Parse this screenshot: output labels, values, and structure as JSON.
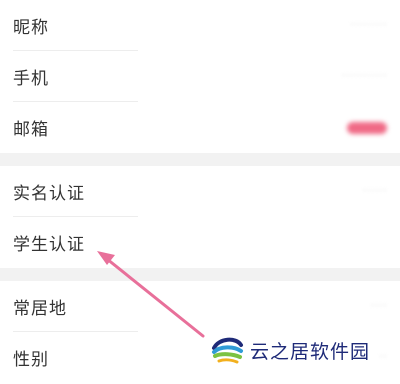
{
  "settings": {
    "group1": [
      {
        "label": "昵称",
        "value": "·········"
      },
      {
        "label": "手机",
        "value": "···········"
      },
      {
        "label": "邮箱",
        "value": "····"
      }
    ],
    "group2": [
      {
        "label": "实名认证",
        "value": "······"
      },
      {
        "label": "学生认证",
        "value": ""
      }
    ],
    "group3": [
      {
        "label": "常居地",
        "value": "····"
      },
      {
        "label": "性别",
        "value": "··"
      }
    ]
  },
  "watermark": {
    "text": "云之居软件园"
  },
  "colors": {
    "background": "#ffffff",
    "separator": "#f2f2f2",
    "arrow": "#e8709a",
    "email_badge": "#f06a86",
    "watermark_text": "#1e2a78"
  }
}
